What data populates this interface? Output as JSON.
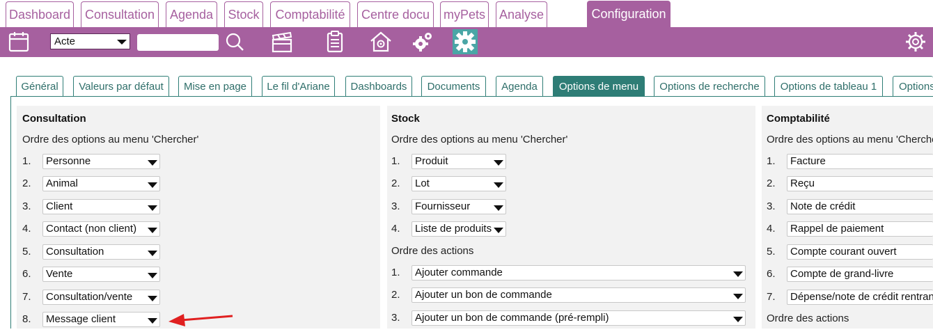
{
  "top_tabs": [
    {
      "label": "Dashboard",
      "active": false
    },
    {
      "label": "Consultation",
      "active": false
    },
    {
      "label": "Agenda",
      "active": false
    },
    {
      "label": "Stock",
      "active": false
    },
    {
      "label": "Comptabilité",
      "active": false
    },
    {
      "label": "Centre docu",
      "active": false
    },
    {
      "label": "myPets",
      "active": false
    },
    {
      "label": "Analyse",
      "active": false
    },
    {
      "label": "Configuration",
      "active": true
    }
  ],
  "toolbar": {
    "search_type_value": "Acte",
    "search_input_value": "",
    "icons": [
      "calendar-icon",
      "search-icon",
      "clapperboard-icon",
      "clipboard-icon",
      "home-gear-icon",
      "gears-icon",
      "gear-icon",
      "settings-gear-icon"
    ]
  },
  "settings_tabs": [
    {
      "label": "Général",
      "active": false
    },
    {
      "label": "Valeurs par défaut",
      "active": false
    },
    {
      "label": "Mise en page",
      "active": false
    },
    {
      "label": "Le fil d'Ariane",
      "active": false
    },
    {
      "label": "Dashboards",
      "active": false
    },
    {
      "label": "Documents",
      "active": false
    },
    {
      "label": "Agenda",
      "active": false
    },
    {
      "label": "Options de menu",
      "active": true
    },
    {
      "label": "Options de recherche",
      "active": false
    },
    {
      "label": "Options de tableau 1",
      "active": false
    },
    {
      "label": "Options",
      "active": false
    }
  ],
  "consultation": {
    "title": "Consultation",
    "search_order_label": "Ordre des options au menu 'Chercher'",
    "search_options": [
      {
        "num": "1.",
        "value": "Personne"
      },
      {
        "num": "2.",
        "value": "Animal"
      },
      {
        "num": "3.",
        "value": "Client"
      },
      {
        "num": "4.",
        "value": "Contact (non client)"
      },
      {
        "num": "5.",
        "value": "Consultation"
      },
      {
        "num": "6.",
        "value": "Vente"
      },
      {
        "num": "7.",
        "value": "Consultation/vente"
      },
      {
        "num": "8.",
        "value": "Message client"
      }
    ]
  },
  "stock": {
    "title": "Stock",
    "search_order_label": "Ordre des options au menu 'Chercher'",
    "search_options": [
      {
        "num": "1.",
        "value": "Produit"
      },
      {
        "num": "2.",
        "value": "Lot"
      },
      {
        "num": "3.",
        "value": "Fournisseur"
      },
      {
        "num": "4.",
        "value": "Liste de produits"
      }
    ],
    "actions_label": "Ordre des actions",
    "actions": [
      {
        "num": "1.",
        "value": "Ajouter commande"
      },
      {
        "num": "2.",
        "value": "Ajouter un bon de commande"
      },
      {
        "num": "3.",
        "value": "Ajouter un bon de commande (pré-rempli)"
      }
    ]
  },
  "comptabilite": {
    "title": "Comptabilité",
    "search_order_label": "Ordre des options au menu 'Chercher'",
    "search_options": [
      {
        "num": "1.",
        "value": "Facture"
      },
      {
        "num": "2.",
        "value": "Reçu"
      },
      {
        "num": "3.",
        "value": "Note de crédit"
      },
      {
        "num": "4.",
        "value": "Rappel de paiement"
      },
      {
        "num": "5.",
        "value": "Compte courant ouvert"
      },
      {
        "num": "6.",
        "value": "Compte de grand-livre"
      },
      {
        "num": "7.",
        "value": "Dépense/note de crédit rentrante"
      }
    ],
    "actions_label": "Ordre des actions"
  },
  "colors": {
    "purple": "#a6609f",
    "teal": "#2e7d76",
    "active_gear_bg": "#4aa6a6",
    "annotation_arrow": "#e02020"
  }
}
